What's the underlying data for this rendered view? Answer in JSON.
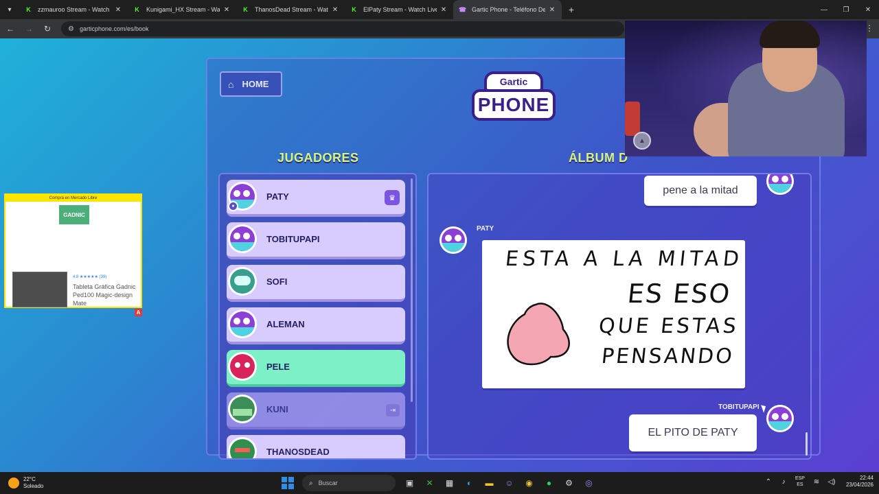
{
  "browser": {
    "tabs": [
      {
        "title": "zzmauroo Stream - Watch Live",
        "favicon": "kick-icon",
        "active": false
      },
      {
        "title": "Kunigami_HX Stream - Watch Li",
        "favicon": "kick-icon",
        "active": false
      },
      {
        "title": "ThanosDead Stream - Watch Li",
        "favicon": "kick-icon",
        "active": false
      },
      {
        "title": "ElPaty Stream - Watch Live on K",
        "favicon": "kick-icon",
        "active": false
      },
      {
        "title": "Gartic Phone - Teléfono Descon",
        "favicon": "gartic-icon",
        "active": true
      }
    ],
    "url": "garticphone.com/es/book"
  },
  "ad": {
    "header": "Comprá en Mercado Libre",
    "brand": "GADNIC",
    "rating": "4.8",
    "rating_count": "(39)",
    "stars": "★★★★★",
    "title": "Tableta Gráfica Gadnic Ped100 Magic-design Mate",
    "badge": "A",
    "accent": "#ffe600"
  },
  "game": {
    "home_label": "HOME",
    "logo_top": "Gartic",
    "logo_bottom": "PHONE",
    "players_heading": "JUGADORES",
    "album_heading": "ÁLBUM D",
    "players": [
      {
        "name": "PATY",
        "avatar": "bird-avatar-icon",
        "owner": true,
        "state": "normal"
      },
      {
        "name": "TOBITUPAPI",
        "avatar": "bird-avatar-icon",
        "owner": false,
        "state": "normal"
      },
      {
        "name": "SOFI",
        "avatar": "robot-avatar-icon",
        "owner": false,
        "state": "normal"
      },
      {
        "name": "ALEMAN",
        "avatar": "bird-avatar-icon",
        "owner": false,
        "state": "normal"
      },
      {
        "name": "PELE",
        "avatar": "devil-avatar-icon",
        "owner": false,
        "state": "highlighted"
      },
      {
        "name": "KUNI",
        "avatar": "croc-avatar-icon",
        "owner": false,
        "state": "disconnected"
      },
      {
        "name": "THANOSDEAD",
        "avatar": "goblin-avatar-icon",
        "owner": false,
        "state": "normal"
      }
    ],
    "album": {
      "entries": [
        {
          "type": "text",
          "author": "",
          "text": "pene a la mitad"
        },
        {
          "type": "drawing",
          "author": "PATY",
          "drawing_text": [
            "ESTA A LA MITAD",
            "ES ESO",
            "QUE ESTAS",
            "PENSANDO"
          ]
        },
        {
          "type": "text",
          "author": "TOBITUPAPI",
          "text": "EL PITO DE PATY"
        }
      ]
    },
    "colors": {
      "heading": "#d6f57a",
      "highlight": "#7df0c8",
      "card": "#d8ccff"
    }
  },
  "taskbar": {
    "weather_temp": "22°C",
    "weather_text": "Soleado",
    "search_placeholder": "Buscar",
    "lang_top": "ESP",
    "lang_bottom": "ES",
    "time": "22:44",
    "date": "23/04/2026"
  }
}
